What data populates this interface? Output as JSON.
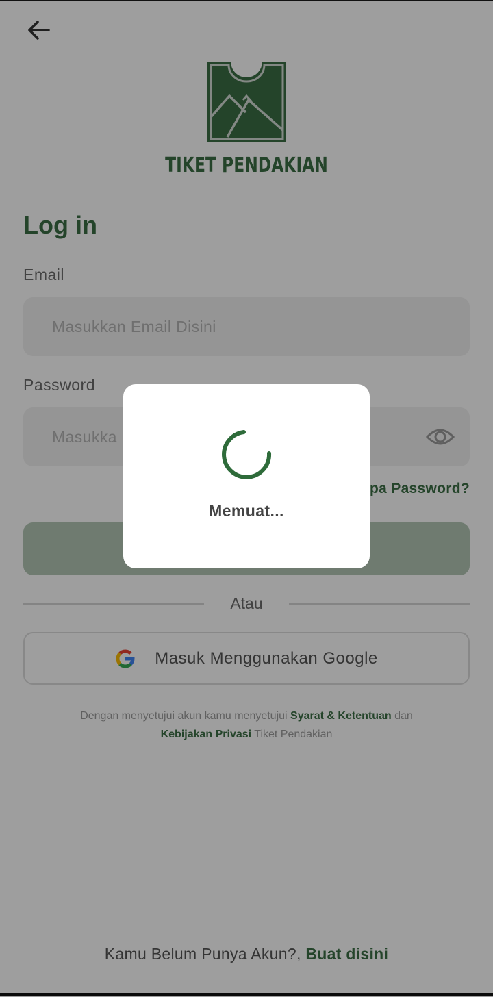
{
  "brand": {
    "name": "TIKET PENDAKIAN",
    "logo_icon": "mountain-ticket-icon"
  },
  "header": {
    "back_icon": "arrow-left-icon"
  },
  "login": {
    "title": "Log in",
    "email_label": "Email",
    "email_placeholder": "Masukkan Email Disini",
    "password_label": "Password",
    "password_placeholder_visible": "Masukka",
    "forgot_visible": "pa Password?",
    "divider": "Atau",
    "google_label": "Masuk Menggunakan Google"
  },
  "terms": {
    "prefix": "Dengan menyetujui akun kamu menyetujui",
    "link1": "Syarat & Ketentuan",
    "mid": "dan",
    "link2": "Kebijakan Privasi",
    "suffix": "Tiket Pendakian"
  },
  "footer": {
    "text": "Kamu Belum Punya Akun?,",
    "link": "Buat disini"
  },
  "loading_dialog": {
    "text": "Memuat..."
  },
  "colors": {
    "brand_green": "#3b6e45",
    "spinner": "#2e6b3a",
    "overlay": "rgba(0,0,0,0.38)"
  }
}
